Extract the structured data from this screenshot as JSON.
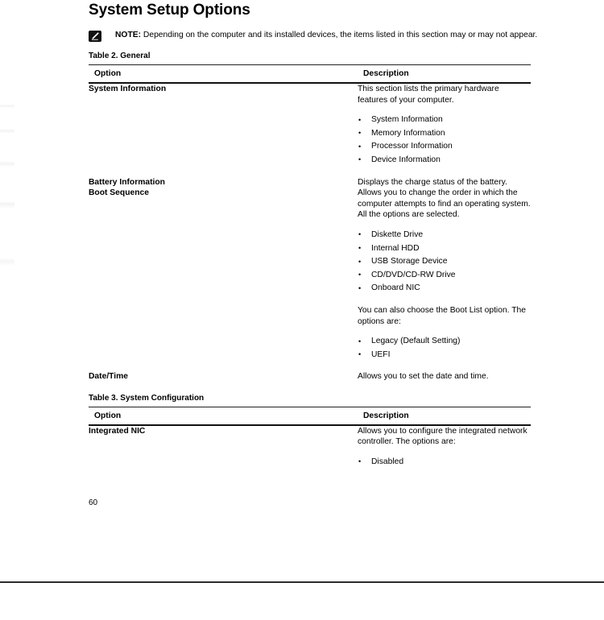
{
  "document": {
    "title": "System Setup Options",
    "page_number": "60"
  },
  "note": {
    "icon": "note-pencil-icon",
    "label": "NOTE:",
    "text": " Depending on the computer and its installed devices, the items listed in this section may or may not appear."
  },
  "tables": [
    {
      "caption": "Table 2. General",
      "columns": [
        "Option",
        "Description"
      ],
      "rows": [
        {
          "option": "System Information",
          "blocks": [
            {
              "type": "paragraph",
              "text": "This section lists the primary hardware features of your computer."
            },
            {
              "type": "list",
              "items": [
                "System Information",
                "Memory Information",
                "Processor Information",
                "Device Information"
              ]
            }
          ]
        },
        {
          "option": "Battery Information",
          "blocks": [
            {
              "type": "paragraph",
              "text": "Displays the charge status of the battery."
            }
          ]
        },
        {
          "option": "Boot Sequence",
          "blocks": [
            {
              "type": "paragraph",
              "text": "Allows you to change the order in which the computer attempts to find an operating system. All the options are selected."
            },
            {
              "type": "list",
              "items": [
                "Diskette Drive",
                "Internal HDD",
                "USB Storage Device",
                "CD/DVD/CD-RW Drive",
                "Onboard NIC"
              ]
            },
            {
              "type": "paragraph",
              "text": "You can also choose the Boot List option. The options are:"
            },
            {
              "type": "list",
              "items": [
                "Legacy (Default Setting)",
                "UEFI"
              ]
            }
          ]
        },
        {
          "option": "Date/Time",
          "blocks": [
            {
              "type": "paragraph",
              "text": "Allows you to set the date and time."
            }
          ]
        }
      ]
    },
    {
      "caption": "Table 3. System Configuration",
      "columns": [
        "Option",
        "Description"
      ],
      "rows": [
        {
          "option": "Integrated NIC",
          "blocks": [
            {
              "type": "paragraph",
              "text": "Allows you to configure the integrated network controller. The options are:"
            },
            {
              "type": "list",
              "items": [
                "Disabled"
              ]
            }
          ]
        }
      ]
    }
  ],
  "colors": {
    "text": "#000000",
    "rule": "#111111",
    "page_background": "#ffffff"
  }
}
